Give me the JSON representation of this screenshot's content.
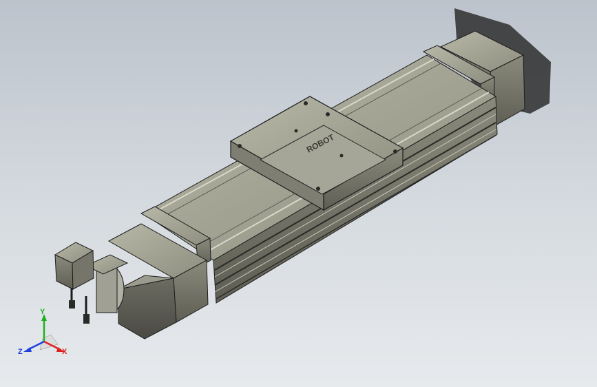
{
  "viewport": {
    "background_top": "#bcc3cc",
    "background_bottom": "#e7eaed"
  },
  "model": {
    "logo_text": "ROBOT",
    "body_color": "#8a8a7c",
    "edge_color": "#1c1c1c",
    "shadow_color": "#333333"
  },
  "triad": {
    "x_label": "X",
    "y_label": "Y",
    "z_label": "Z",
    "x_color": "#e02020",
    "y_color": "#20b020",
    "z_color": "#2040e0"
  }
}
